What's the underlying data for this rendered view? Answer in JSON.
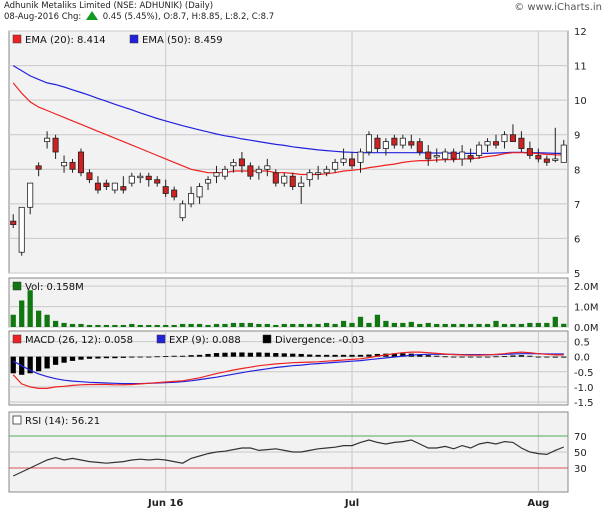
{
  "header": {
    "line1": "Adhunik Metaliks Limited (NSE: ADHUNIK) (Daily)",
    "date": "08-Aug-2016 Chg:",
    "change": "0.45 (5.45%), O:8.7, H:8.85, L:8.2, C:8.7",
    "watermark": "© www.iCharts.in"
  },
  "colors": {
    "up": "#ffffff",
    "down": "#cc2222",
    "ema20": "#ee2222",
    "ema50": "#2222dd",
    "vol": "#117711",
    "macd": "#ee2222",
    "exp": "#2222dd",
    "div": "#000000",
    "rsi": "#333333",
    "panel": "#f2f2f2"
  },
  "chart_data": [
    {
      "type": "candlestick",
      "title": "",
      "legend": [
        "EMA (20): 8.414",
        "EMA (50): 8.459"
      ],
      "ylim": [
        5,
        12
      ],
      "yticks": [
        5,
        6,
        7,
        8,
        9,
        10,
        11,
        12
      ],
      "xticks": [
        {
          "label": "Jun 16",
          "index": 18
        },
        {
          "label": "Jul",
          "index": 40
        },
        {
          "label": "Aug",
          "index": 62
        }
      ],
      "ohlc": [
        [
          6.5,
          6.7,
          6.3,
          6.4
        ],
        [
          5.6,
          6.9,
          5.5,
          6.9
        ],
        [
          6.9,
          7.6,
          6.7,
          7.6
        ],
        [
          8.1,
          8.2,
          7.8,
          8.0
        ],
        [
          8.8,
          9.1,
          8.6,
          8.9
        ],
        [
          8.9,
          9.0,
          8.3,
          8.5
        ],
        [
          8.1,
          8.4,
          7.9,
          8.2
        ],
        [
          8.2,
          8.3,
          7.9,
          8.0
        ],
        [
          8.5,
          8.6,
          7.8,
          7.9
        ],
        [
          7.9,
          8.0,
          7.6,
          7.7
        ],
        [
          7.6,
          7.8,
          7.3,
          7.4
        ],
        [
          7.6,
          7.7,
          7.4,
          7.5
        ],
        [
          7.4,
          7.6,
          7.3,
          7.6
        ],
        [
          7.5,
          7.8,
          7.3,
          7.4
        ],
        [
          7.6,
          7.9,
          7.5,
          7.8
        ],
        [
          7.8,
          7.9,
          7.6,
          7.8
        ],
        [
          7.8,
          7.9,
          7.5,
          7.7
        ],
        [
          7.7,
          7.8,
          7.5,
          7.6
        ],
        [
          7.5,
          7.7,
          7.2,
          7.3
        ],
        [
          7.4,
          7.5,
          7.1,
          7.2
        ],
        [
          6.6,
          7.1,
          6.5,
          7.0
        ],
        [
          7.0,
          7.5,
          6.9,
          7.3
        ],
        [
          7.2,
          7.6,
          7.0,
          7.5
        ],
        [
          7.6,
          7.8,
          7.4,
          7.7
        ],
        [
          7.8,
          8.1,
          7.6,
          7.9
        ],
        [
          7.8,
          8.1,
          7.7,
          8.0
        ],
        [
          8.1,
          8.3,
          7.9,
          8.2
        ],
        [
          8.3,
          8.5,
          7.9,
          8.1
        ],
        [
          8.1,
          8.2,
          7.7,
          7.8
        ],
        [
          7.9,
          8.1,
          7.7,
          8.0
        ],
        [
          8.0,
          8.3,
          7.8,
          8.1
        ],
        [
          7.9,
          8.0,
          7.5,
          7.6
        ],
        [
          7.6,
          7.9,
          7.5,
          7.8
        ],
        [
          7.8,
          7.9,
          7.4,
          7.5
        ],
        [
          7.5,
          7.8,
          7.0,
          7.6
        ],
        [
          7.7,
          8.0,
          7.5,
          7.9
        ],
        [
          7.9,
          8.1,
          7.7,
          7.9
        ],
        [
          7.9,
          8.1,
          7.8,
          8.0
        ],
        [
          8.0,
          8.3,
          7.9,
          8.2
        ],
        [
          8.2,
          8.6,
          8.1,
          8.3
        ],
        [
          8.3,
          8.5,
          8.0,
          8.1
        ],
        [
          8.2,
          8.6,
          7.9,
          8.5
        ],
        [
          8.5,
          9.1,
          8.4,
          9.0
        ],
        [
          8.9,
          9.0,
          8.5,
          8.6
        ],
        [
          8.6,
          8.9,
          8.4,
          8.8
        ],
        [
          8.9,
          9.0,
          8.6,
          8.7
        ],
        [
          8.7,
          9.0,
          8.6,
          8.9
        ],
        [
          8.8,
          9.0,
          8.6,
          8.7
        ],
        [
          8.8,
          8.9,
          8.4,
          8.5
        ],
        [
          8.5,
          8.7,
          8.1,
          8.3
        ],
        [
          8.4,
          8.6,
          8.2,
          8.4
        ],
        [
          8.3,
          8.6,
          8.2,
          8.5
        ],
        [
          8.5,
          8.6,
          8.2,
          8.3
        ],
        [
          8.3,
          8.7,
          8.1,
          8.5
        ],
        [
          8.4,
          8.6,
          8.2,
          8.3
        ],
        [
          8.4,
          8.8,
          8.3,
          8.7
        ],
        [
          8.7,
          8.9,
          8.5,
          8.8
        ],
        [
          8.8,
          9.0,
          8.6,
          8.7
        ],
        [
          8.8,
          9.1,
          8.6,
          9.0
        ],
        [
          9.0,
          9.3,
          8.8,
          8.8
        ],
        [
          8.9,
          9.1,
          8.5,
          8.6
        ],
        [
          8.6,
          8.8,
          8.3,
          8.4
        ],
        [
          8.4,
          8.6,
          8.2,
          8.3
        ],
        [
          8.3,
          8.4,
          8.1,
          8.2
        ],
        [
          8.3,
          9.2,
          8.2,
          8.3
        ],
        [
          8.2,
          8.85,
          8.2,
          8.7
        ]
      ],
      "ema20": [
        10.5,
        10.2,
        9.95,
        9.8,
        9.7,
        9.6,
        9.5,
        9.4,
        9.3,
        9.2,
        9.1,
        9.0,
        8.9,
        8.8,
        8.7,
        8.6,
        8.5,
        8.4,
        8.3,
        8.2,
        8.1,
        8.0,
        7.95,
        7.9,
        7.9,
        7.9,
        7.95,
        7.95,
        7.95,
        7.95,
        7.95,
        7.9,
        7.9,
        7.88,
        7.85,
        7.85,
        7.85,
        7.87,
        7.9,
        7.95,
        7.97,
        8.0,
        8.05,
        8.08,
        8.12,
        8.15,
        8.2,
        8.23,
        8.25,
        8.25,
        8.27,
        8.28,
        8.28,
        8.3,
        8.3,
        8.33,
        8.37,
        8.4,
        8.45,
        8.48,
        8.48,
        8.47,
        8.45,
        8.43,
        8.42,
        8.414
      ],
      "ema50": [
        11.0,
        10.85,
        10.7,
        10.6,
        10.5,
        10.45,
        10.38,
        10.3,
        10.22,
        10.14,
        10.05,
        9.97,
        9.88,
        9.8,
        9.72,
        9.63,
        9.55,
        9.47,
        9.4,
        9.33,
        9.26,
        9.2,
        9.14,
        9.08,
        9.02,
        8.97,
        8.93,
        8.88,
        8.84,
        8.8,
        8.76,
        8.72,
        8.69,
        8.65,
        8.62,
        8.59,
        8.56,
        8.54,
        8.52,
        8.5,
        8.49,
        8.48,
        8.48,
        8.48,
        8.48,
        8.48,
        8.48,
        8.48,
        8.48,
        8.47,
        8.47,
        8.47,
        8.46,
        8.46,
        8.46,
        8.46,
        8.46,
        8.47,
        8.48,
        8.49,
        8.49,
        8.48,
        8.48,
        8.47,
        8.46,
        8.459
      ]
    },
    {
      "type": "bar",
      "title": "",
      "legend": [
        "Vol: 0.158M"
      ],
      "ylim": [
        0,
        2.4
      ],
      "yticks": [
        {
          "v": 2.0,
          "label": "2.0M"
        },
        {
          "v": 1.0,
          "label": "1.0M"
        },
        {
          "v": 0.0,
          "label": "0.0M"
        }
      ],
      "values": [
        0.6,
        1.3,
        1.8,
        0.8,
        0.6,
        0.3,
        0.2,
        0.15,
        0.15,
        0.1,
        0.1,
        0.1,
        0.1,
        0.1,
        0.15,
        0.1,
        0.1,
        0.1,
        0.1,
        0.1,
        0.15,
        0.15,
        0.15,
        0.1,
        0.15,
        0.15,
        0.2,
        0.2,
        0.2,
        0.15,
        0.15,
        0.1,
        0.15,
        0.15,
        0.15,
        0.15,
        0.15,
        0.2,
        0.15,
        0.3,
        0.2,
        0.5,
        0.2,
        0.6,
        0.3,
        0.2,
        0.2,
        0.25,
        0.15,
        0.2,
        0.15,
        0.15,
        0.15,
        0.15,
        0.15,
        0.15,
        0.15,
        0.3,
        0.15,
        0.15,
        0.15,
        0.2,
        0.2,
        0.2,
        0.5,
        0.158
      ]
    },
    {
      "type": "line",
      "title": "",
      "legend": [
        "MACD (26, 12): 0.058",
        "EXP (9): 0.088",
        "Divergence: -0.03"
      ],
      "ylim": [
        -1.6,
        0.85
      ],
      "yticks": [
        {
          "v": 0.5,
          "label": "0.5"
        },
        {
          "v": 0.0,
          "label": "0.0"
        },
        {
          "v": -0.5,
          "label": "-0.5"
        },
        {
          "v": -1.0,
          "label": "-1.0"
        },
        {
          "v": -1.5,
          "label": "-1.5"
        }
      ],
      "macd": [
        -0.6,
        -0.9,
        -1.0,
        -1.05,
        -1.05,
        -1.0,
        -0.98,
        -0.95,
        -0.93,
        -0.92,
        -0.92,
        -0.92,
        -0.93,
        -0.93,
        -0.92,
        -0.9,
        -0.88,
        -0.86,
        -0.84,
        -0.82,
        -0.8,
        -0.75,
        -0.7,
        -0.63,
        -0.56,
        -0.5,
        -0.44,
        -0.39,
        -0.35,
        -0.3,
        -0.27,
        -0.24,
        -0.22,
        -0.2,
        -0.19,
        -0.18,
        -0.17,
        -0.15,
        -0.13,
        -0.11,
        -0.09,
        -0.07,
        -0.03,
        0.02,
        0.06,
        0.1,
        0.13,
        0.15,
        0.15,
        0.13,
        0.11,
        0.09,
        0.07,
        0.06,
        0.05,
        0.05,
        0.06,
        0.08,
        0.1,
        0.13,
        0.15,
        0.13,
        0.1,
        0.08,
        0.06,
        0.058
      ],
      "exp": [
        -0.15,
        -0.3,
        -0.45,
        -0.57,
        -0.66,
        -0.73,
        -0.78,
        -0.81,
        -0.83,
        -0.85,
        -0.86,
        -0.87,
        -0.88,
        -0.89,
        -0.89,
        -0.89,
        -0.88,
        -0.87,
        -0.86,
        -0.85,
        -0.83,
        -0.8,
        -0.76,
        -0.72,
        -0.68,
        -0.63,
        -0.58,
        -0.53,
        -0.48,
        -0.44,
        -0.4,
        -0.36,
        -0.33,
        -0.3,
        -0.28,
        -0.25,
        -0.23,
        -0.21,
        -0.19,
        -0.17,
        -0.15,
        -0.13,
        -0.1,
        -0.07,
        -0.04,
        -0.01,
        0.02,
        0.05,
        0.07,
        0.08,
        0.08,
        0.08,
        0.08,
        0.07,
        0.07,
        0.07,
        0.07,
        0.07,
        0.08,
        0.09,
        0.1,
        0.1,
        0.1,
        0.09,
        0.09,
        0.088
      ],
      "divergence": [
        -0.55,
        -0.6,
        -0.55,
        -0.48,
        -0.39,
        -0.27,
        -0.2,
        -0.14,
        -0.1,
        -0.07,
        -0.06,
        -0.05,
        -0.05,
        -0.04,
        -0.03,
        -0.01,
        0.0,
        0.01,
        0.02,
        0.03,
        0.03,
        0.05,
        0.06,
        0.09,
        0.12,
        0.13,
        0.14,
        0.14,
        0.13,
        0.14,
        0.13,
        0.12,
        0.11,
        0.1,
        0.09,
        0.07,
        0.06,
        0.06,
        0.06,
        0.06,
        0.06,
        0.06,
        0.07,
        0.09,
        0.1,
        0.11,
        0.11,
        0.1,
        0.08,
        0.05,
        0.03,
        0.01,
        -0.01,
        -0.01,
        -0.02,
        -0.02,
        -0.01,
        0.01,
        0.02,
        0.04,
        0.05,
        0.03,
        0.0,
        -0.01,
        -0.03,
        -0.03
      ]
    },
    {
      "type": "line",
      "title": "",
      "legend": [
        "RSI (14): 56.21"
      ],
      "ylim": [
        0,
        100
      ],
      "yticks": [
        {
          "v": 70,
          "label": "70"
        },
        {
          "v": 50,
          "label": "50"
        },
        {
          "v": 30,
          "label": "30"
        }
      ],
      "values": [
        20,
        25,
        30,
        35,
        40,
        43,
        40,
        42,
        40,
        38,
        37,
        36,
        37,
        38,
        40,
        41,
        40,
        41,
        40,
        38,
        36,
        42,
        45,
        48,
        50,
        51,
        53,
        55,
        55,
        52,
        53,
        54,
        52,
        50,
        50,
        52,
        54,
        55,
        56,
        58,
        58,
        62,
        65,
        62,
        60,
        62,
        63,
        65,
        60,
        55,
        55,
        57,
        54,
        58,
        55,
        60,
        62,
        60,
        63,
        62,
        55,
        50,
        48,
        47,
        52,
        56.21
      ]
    }
  ]
}
